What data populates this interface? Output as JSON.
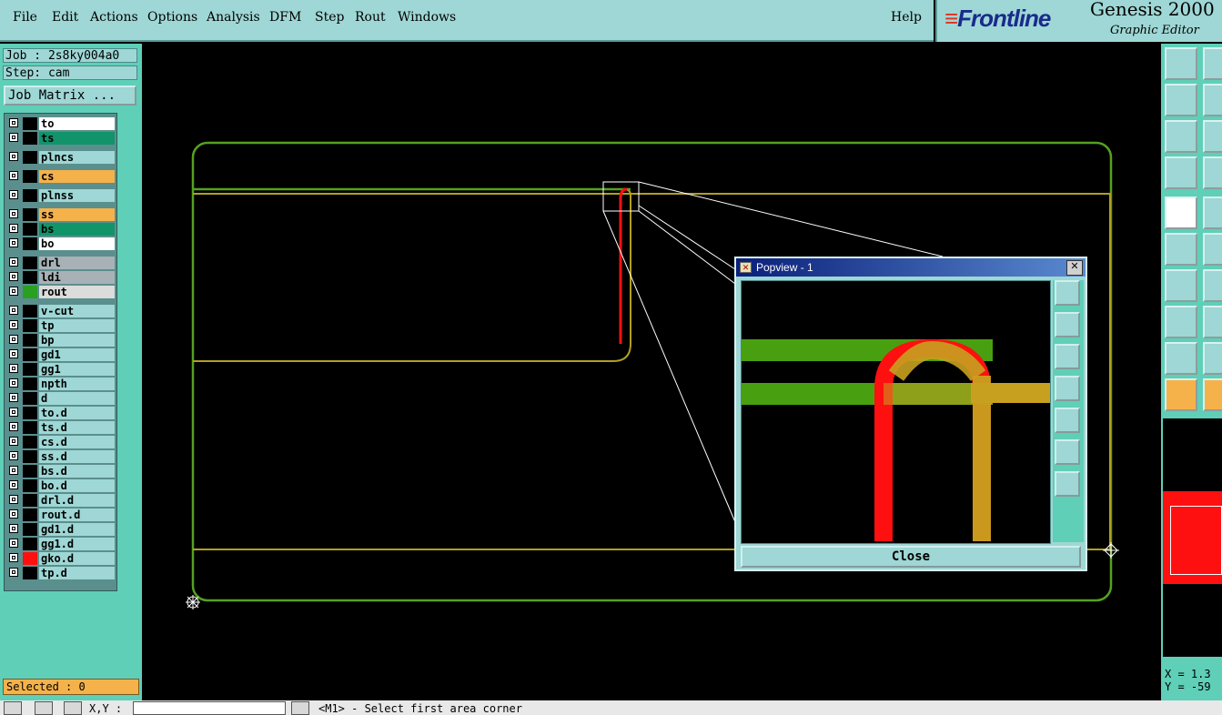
{
  "menubar": {
    "items": [
      "File",
      "Edit",
      "Actions",
      "Options",
      "Analysis",
      "DFM",
      "Step",
      "Rout",
      "Windows"
    ],
    "help": "Help"
  },
  "brand": {
    "logo": "Frontline",
    "title": "Genesis 2000",
    "subtitle": "Graphic Editor"
  },
  "job": {
    "job_label": "Job : 2s8ky004a0",
    "step_label": "Step: cam",
    "matrix_button": "Job Matrix ..."
  },
  "layers": [
    {
      "name": "to",
      "color": "#ffffff",
      "swatch": "#000000"
    },
    {
      "name": "ts",
      "color": "#12946a",
      "swatch": "#000000"
    },
    {
      "name": "plncs",
      "color": "#9ed7d5",
      "swatch": "#000000"
    },
    {
      "name": "cs",
      "color": "#f5b24a",
      "swatch": "#000000"
    },
    {
      "name": "plnss",
      "color": "#9ed7d5",
      "swatch": "#000000"
    },
    {
      "name": "ss",
      "color": "#f5b24a",
      "swatch": "#000000"
    },
    {
      "name": "bs",
      "color": "#12946a",
      "swatch": "#000000"
    },
    {
      "name": "bo",
      "color": "#ffffff",
      "swatch": "#000000"
    },
    {
      "name": "drl",
      "color": "#a8b2b6",
      "swatch": "#000000"
    },
    {
      "name": "ldi",
      "color": "#a8b2b6",
      "swatch": "#000000"
    },
    {
      "name": "rout",
      "color": "#dcdcdc",
      "swatch": "#2aa020"
    },
    {
      "name": "v-cut",
      "color": "#9ed7d5",
      "swatch": "#000000"
    },
    {
      "name": "tp",
      "color": "#9ed7d5",
      "swatch": "#000000"
    },
    {
      "name": "bp",
      "color": "#9ed7d5",
      "swatch": "#000000"
    },
    {
      "name": "gd1",
      "color": "#9ed7d5",
      "swatch": "#000000"
    },
    {
      "name": "gg1",
      "color": "#9ed7d5",
      "swatch": "#000000"
    },
    {
      "name": "npth",
      "color": "#9ed7d5",
      "swatch": "#000000"
    },
    {
      "name": "d",
      "color": "#9ed7d5",
      "swatch": "#000000"
    },
    {
      "name": "to.d",
      "color": "#9ed7d5",
      "swatch": "#000000"
    },
    {
      "name": "ts.d",
      "color": "#9ed7d5",
      "swatch": "#000000"
    },
    {
      "name": "cs.d",
      "color": "#9ed7d5",
      "swatch": "#000000"
    },
    {
      "name": "ss.d",
      "color": "#9ed7d5",
      "swatch": "#000000"
    },
    {
      "name": "bs.d",
      "color": "#9ed7d5",
      "swatch": "#000000"
    },
    {
      "name": "bo.d",
      "color": "#9ed7d5",
      "swatch": "#000000"
    },
    {
      "name": "drl.d",
      "color": "#9ed7d5",
      "swatch": "#000000"
    },
    {
      "name": "rout.d",
      "color": "#9ed7d5",
      "swatch": "#000000"
    },
    {
      "name": "gd1.d",
      "color": "#9ed7d5",
      "swatch": "#000000"
    },
    {
      "name": "gg1.d",
      "color": "#9ed7d5",
      "swatch": "#000000"
    },
    {
      "name": "gko.d",
      "color": "#9ed7d5",
      "swatch": "#ff1010"
    },
    {
      "name": "tp.d",
      "color": "#9ed7d5",
      "swatch": "#000000"
    }
  ],
  "selected": "Selected : 0",
  "popview": {
    "title": "Popview - 1",
    "close_label": "Close",
    "close_x": "✕"
  },
  "coords": {
    "x": "X = 1.3",
    "y": "Y = -59"
  },
  "statusbar": {
    "xy_label": "X,Y :",
    "message": "<M1> - Select first area corner"
  },
  "colors": {
    "outline_green": "#55a020",
    "trace_olive": "#b0a020",
    "highlight_red": "#ff1010"
  }
}
